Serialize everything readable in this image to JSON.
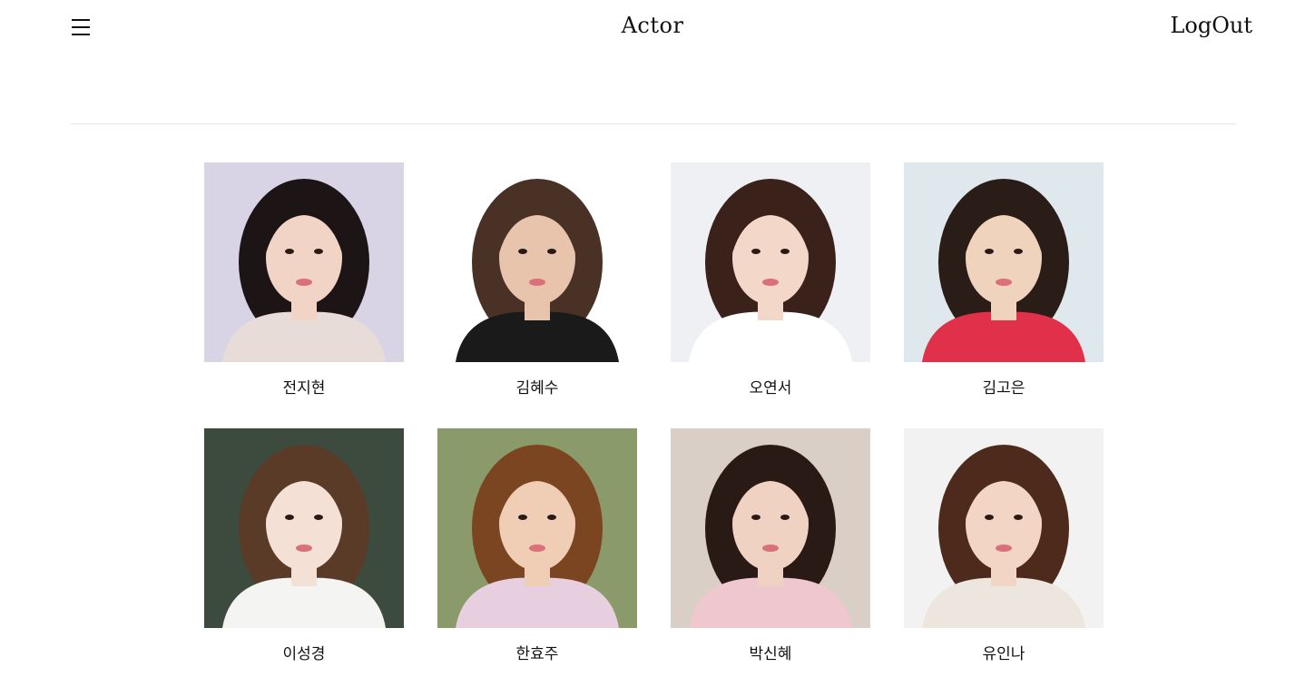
{
  "header": {
    "title": "Actor",
    "logout_label": "LogOut",
    "menu_icon": "hamburger-menu-icon"
  },
  "actors": [
    {
      "name": "전지현",
      "bg": "#d9d3e6",
      "hair": "#1d1416",
      "skin": "#f1d4c6",
      "top": "#e8dcd8"
    },
    {
      "name": "김혜수",
      "bg": "#ffffff",
      "hair": "#4a3126",
      "skin": "#e8c4ad",
      "top": "#1a1a1a"
    },
    {
      "name": "오연서",
      "bg": "#eef0f3",
      "hair": "#3a211a",
      "skin": "#f3d7c9",
      "top": "#ffffff"
    },
    {
      "name": "김고은",
      "bg": "#dfe8ec",
      "hair": "#2a1c17",
      "skin": "#f0d3bd",
      "top": "#e0304a"
    },
    {
      "name": "이성경",
      "bg": "#3d4a3e",
      "hair": "#5a3b27",
      "skin": "#f5e0d6",
      "top": "#f4f4f2"
    },
    {
      "name": "한효주",
      "bg": "#8a9a6a",
      "hair": "#7a4520",
      "skin": "#f0cdb5",
      "top": "#e8cfe0"
    },
    {
      "name": "박신혜",
      "bg": "#d9cfc7",
      "hair": "#2a1a16",
      "skin": "#f0d2c2",
      "top": "#efc7cf"
    },
    {
      "name": "유인나",
      "bg": "#f2f2f2",
      "hair": "#4e2a1c",
      "skin": "#f3d5c6",
      "top": "#ece6de"
    }
  ]
}
